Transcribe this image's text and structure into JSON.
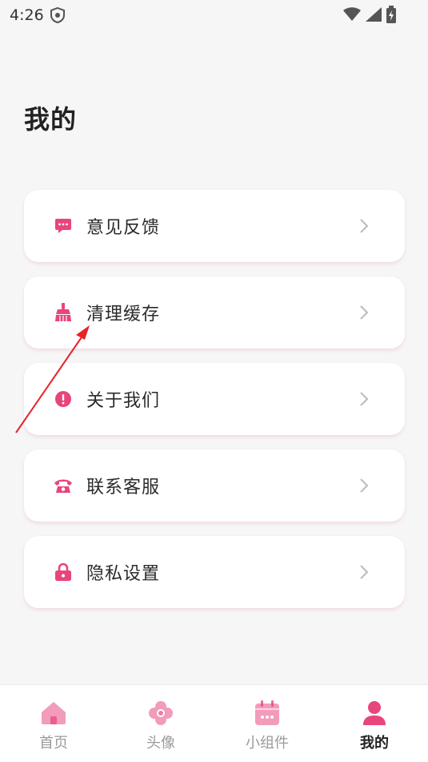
{
  "status_bar": {
    "time": "4:26"
  },
  "page": {
    "title": "我的"
  },
  "menu": {
    "items": [
      {
        "label": "意见反馈",
        "icon": "chat-bubble-icon"
      },
      {
        "label": "清理缓存",
        "icon": "broom-icon"
      },
      {
        "label": "关于我们",
        "icon": "info-alert-icon"
      },
      {
        "label": "联系客服",
        "icon": "telephone-icon"
      },
      {
        "label": "隐私设置",
        "icon": "lock-icon"
      }
    ]
  },
  "bottom_nav": {
    "items": [
      {
        "label": "首页",
        "icon": "home-icon",
        "active": false
      },
      {
        "label": "头像",
        "icon": "flower-icon",
        "active": false
      },
      {
        "label": "小组件",
        "icon": "calendar-widget-icon",
        "active": false
      },
      {
        "label": "我的",
        "icon": "person-icon",
        "active": true
      }
    ]
  },
  "colors": {
    "accent": "#e8457c",
    "accent_light": "#f29bbb",
    "background": "#f6f6f7",
    "card": "#ffffff",
    "annotation": "#e8232a"
  }
}
